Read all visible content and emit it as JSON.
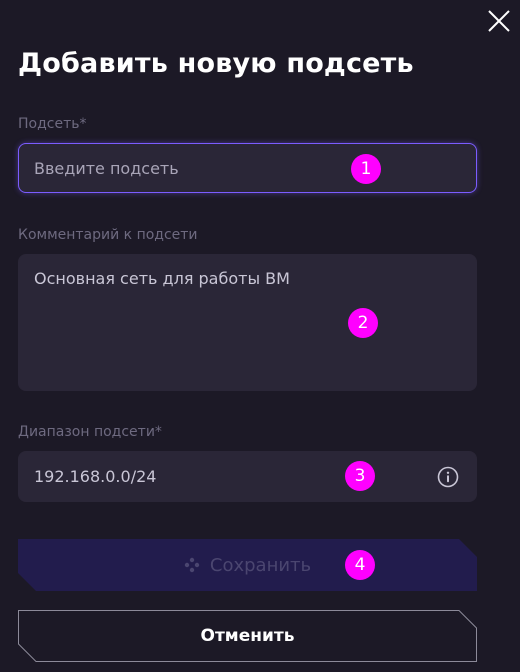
{
  "dialog": {
    "title": "Добавить новую подсеть",
    "close_icon": "close-icon"
  },
  "fields": {
    "subnet": {
      "label": "Подсеть*",
      "placeholder": "Введите подсеть",
      "value": ""
    },
    "comment": {
      "label": "Комментарий к подсети",
      "value": "Основная сеть для работы ВМ"
    },
    "range": {
      "label": "Диапазон подсети*",
      "value": "192.168.0.0/24",
      "info_icon": "info-icon"
    }
  },
  "buttons": {
    "save_label": "Сохранить",
    "save_icon": "sparkle-icon",
    "cancel_label": "Отменить"
  },
  "markers": [
    "1",
    "2",
    "3",
    "4"
  ],
  "colors": {
    "background": "#1c1926",
    "field_bg": "#2a2637",
    "focus_border": "#7b5cff",
    "save_bg": "#221c4d",
    "save_text": "#4b4670",
    "marker": "#ff00ff",
    "label": "#6e6a80"
  }
}
